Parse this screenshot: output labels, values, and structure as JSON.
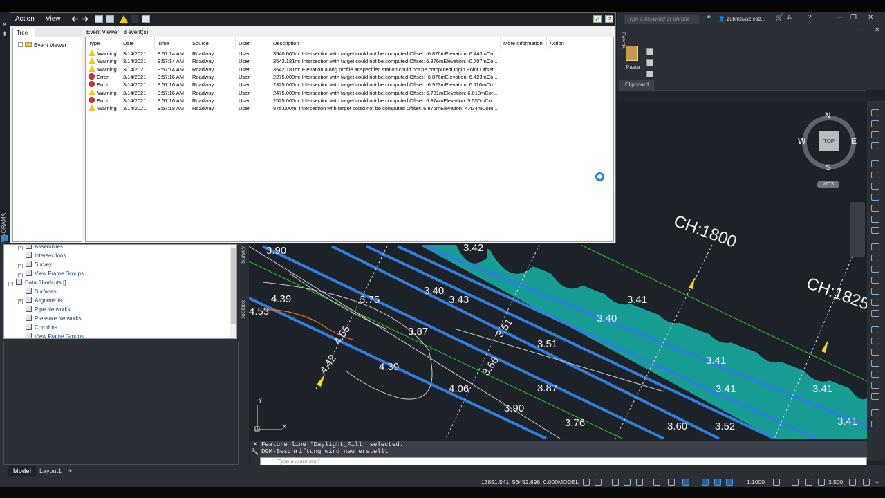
{
  "app": {
    "search_placeholder": "Type a keyword or phrase",
    "user_name": "zulimtiyaz.eliz...",
    "ribbon_tab_label": "Events",
    "clipboard": {
      "paste_label": "Paste",
      "group_label": "Clipboard"
    }
  },
  "viewcube": {
    "n": "N",
    "s": "S",
    "e": "E",
    "w": "W",
    "top": "TOP",
    "wcs": "WCS"
  },
  "event_viewer": {
    "menu": {
      "action": "Action",
      "view": "View"
    },
    "tree_tab": "Tree",
    "tree_root": "Event Viewer",
    "header_title": "Event Viewer",
    "header_count": "8 event(s)",
    "columns": [
      "Type",
      "Date",
      "Time",
      "Source",
      "User",
      "Description",
      "More Information",
      "Action"
    ],
    "events": [
      {
        "type": "Warning",
        "date": "3/14/2021",
        "time": "9:57:14 AM",
        "source": "Roadway",
        "user": "User",
        "description": "3540.000m: Intersection with target could not be computed  Offset: -6.876mElevation: 6.443mCo..."
      },
      {
        "type": "Warning",
        "date": "3/14/2021",
        "time": "9:57:14 AM",
        "source": "Roadway",
        "user": "User",
        "description": "3542.181m: Intersection with target could not be computed  Offset: 6.876mElevation: -0.707mCo..."
      },
      {
        "type": "Warning",
        "date": "3/14/2021",
        "time": "9:57:14 AM",
        "source": "Roadway",
        "user": "User",
        "description": "3542.181m: Elevation along profile at specified station could not be computedOrigin Point  Offset: ..."
      },
      {
        "type": "Error",
        "date": "3/14/2021",
        "time": "9:57:16 AM",
        "source": "Roadway",
        "user": "User",
        "description": "2275.000m: Intersection with target could not be computed  Offset: -6.876mElevation: 6.423mCo..."
      },
      {
        "type": "Error",
        "date": "3/14/2021",
        "time": "9:57:16 AM",
        "source": "Roadway",
        "user": "User",
        "description": "2325.000m: Intersection with target could not be computed  Offset: -6.923mElevation: 6.116mCo..."
      },
      {
        "type": "Warning",
        "date": "3/14/2021",
        "time": "9:57:16 AM",
        "source": "Roadway",
        "user": "User",
        "description": "2475.000m: Intersection with target could not be computed  Offset: 6.781mElevation: 6.018mCor..."
      },
      {
        "type": "Error",
        "date": "3/14/2021",
        "time": "9:57:16 AM",
        "source": "Roadway",
        "user": "User",
        "description": "2525.000m: Intersection with target could not be computed  Offset: 6.874mElevation: 5.550mCor..."
      },
      {
        "type": "Warning",
        "date": "3/14/2021",
        "time": "9:57:18 AM",
        "source": "Roadway",
        "user": "User",
        "description": "875.000m: Intersection with target could not be computed  Offset: 6.876mElevation: 4.434mCorn..."
      }
    ]
  },
  "prospector": {
    "items": [
      {
        "label": "Assemblies"
      },
      {
        "label": "Intersections"
      },
      {
        "label": "Survey"
      },
      {
        "label": "View Frame Groups"
      },
      {
        "label": "Data Shortcuts []"
      },
      {
        "label": "Surfaces"
      },
      {
        "label": "Alignments"
      },
      {
        "label": "Pipe Networks"
      },
      {
        "label": "Pressure Networks"
      },
      {
        "label": "Corridors"
      },
      {
        "label": "View Frame Groups"
      }
    ],
    "side_tabs": {
      "survey": "Survey",
      "toolbox": "Toolbox"
    },
    "panorama": "PANORAMA"
  },
  "drawing": {
    "labels": [
      "3.90",
      "4.39",
      "4.53",
      "3.42",
      "3.40",
      "3.43",
      "3.75",
      "3.41",
      "3.40",
      "3.51",
      "3.87",
      "4.56",
      "4.42",
      "4.39",
      "4.06",
      "3.90",
      "3.76",
      "3.87",
      "3.41",
      "3.41",
      "3.60",
      "3.52",
      "3.41",
      "3.41",
      "3.51",
      "3.66"
    ],
    "chainages": [
      "CH:1800",
      "CH:1825"
    ]
  },
  "command": {
    "history": [
      "Feature line 'Daylight_Fill' selected.",
      "DGM-Beschriftung wird neu erstellt"
    ],
    "placeholder": "Type a command"
  },
  "layout_tabs": {
    "model": "Model",
    "layout1": "Layout1",
    "add": "+"
  },
  "status": {
    "coords": "13851.541, 56452.898, 0.000",
    "space": "MODEL",
    "scale": "1:1000",
    "value": "3.500"
  },
  "colors": {
    "canvas": "#1c2228",
    "alignment_blue": "#2f7fe0",
    "hatch_teal": "#17b3a8",
    "marker_yellow": "#f5e100",
    "warning_yellow": "#f2c811",
    "error_red": "#d83232"
  }
}
